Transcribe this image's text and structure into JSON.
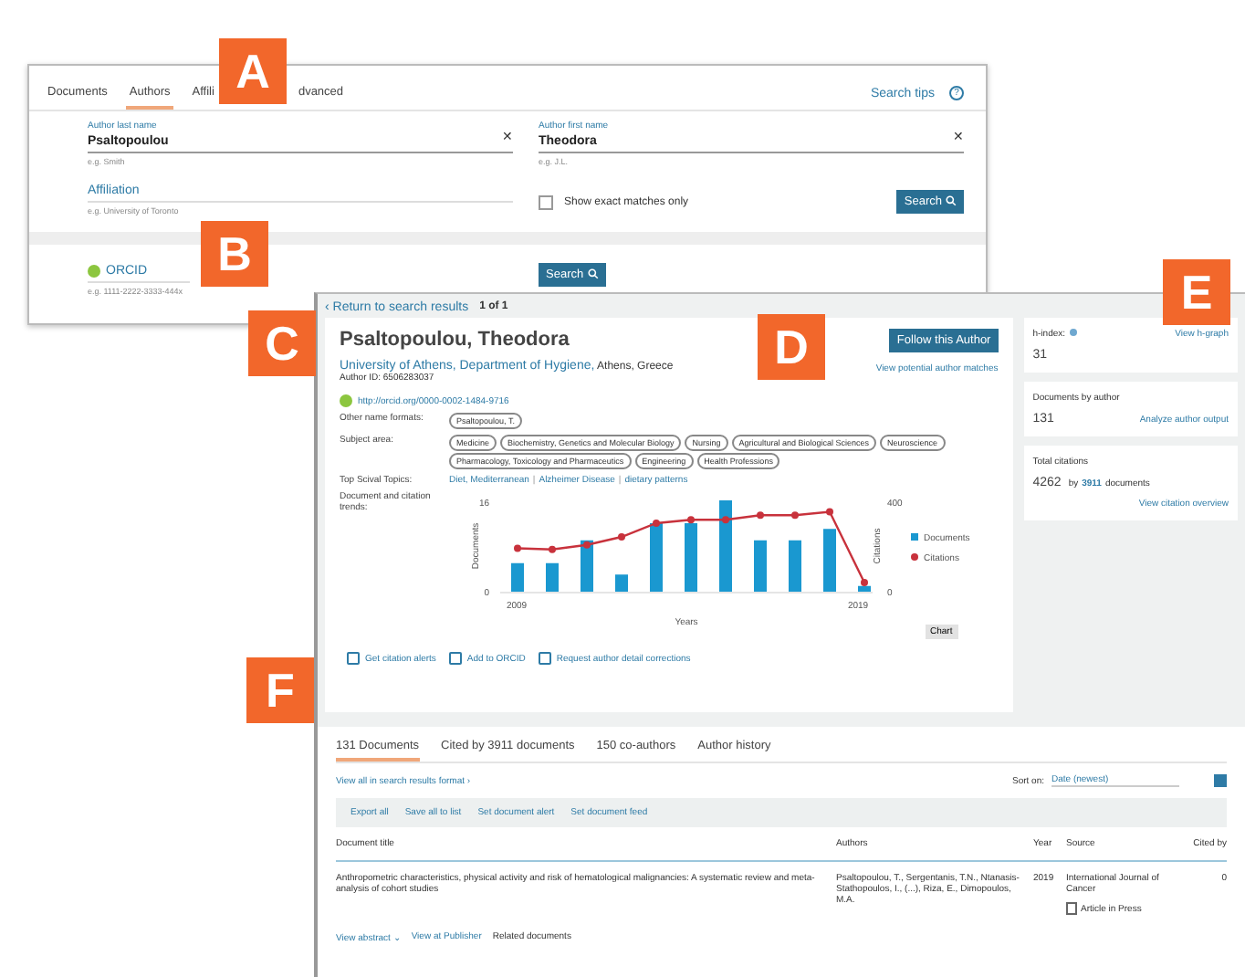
{
  "search_panel": {
    "tabs": [
      {
        "label": "Documents",
        "selected": false
      },
      {
        "label": "Authors",
        "selected": true
      },
      {
        "label": "Affili",
        "selected": false
      },
      {
        "label": "dvanced",
        "selected": false
      }
    ],
    "search_tips": "Search tips",
    "help_mark": "?",
    "clear_mark": "✕",
    "last_name": {
      "label": "Author last name",
      "value": "Psaltopoulou",
      "hint": "e.g. Smith"
    },
    "first_name": {
      "label": "Author first name",
      "value": "Theodora",
      "hint": "e.g. J.L."
    },
    "affiliation": {
      "placeholder": "Affiliation",
      "hint": "e.g. University of Toronto"
    },
    "exact_matches": {
      "label": "Show exact matches only",
      "checked": false
    },
    "search_button": "Search",
    "orcid": {
      "placeholder": "ORCID",
      "hint": "e.g. 1111-2222-3333-444x"
    },
    "orcid_search_button": "Search"
  },
  "author_page": {
    "back_link": "‹ Return to search results",
    "pager": "1 of 1",
    "name": "Psaltopoulou, Theodora",
    "affiliation_link": "University of Athens, Department of Hygiene,",
    "affiliation_place": "Athens, Greece",
    "author_id": "Author ID: 6506283037",
    "orcid_link": "http://orcid.org/0000-0002-1484-9716",
    "follow_button": "Follow this Author",
    "matches_link": "View potential author matches",
    "other_names_label": "Other name formats:",
    "other_names": [
      "Psaltopoulou, T."
    ],
    "subject_label": "Subject area:",
    "subjects": [
      "Medicine",
      "Biochemistry, Genetics and Molecular Biology",
      "Nursing",
      "Agricultural and Biological Sciences",
      "Neuroscience",
      "Pharmacology, Toxicology and Pharmaceutics",
      "Engineering",
      "Health Professions"
    ],
    "topics_label": "Top Scival Topics:",
    "topic_separator": "|",
    "topics": [
      "Diet, Mediterranean",
      "Alzheimer Disease",
      "dietary patterns"
    ],
    "trends_label": "Document and citation trends:",
    "chart": {
      "left_ticks": [
        "16",
        "0"
      ],
      "right_ticks": [
        "400",
        "0"
      ],
      "x_labels": [
        "2009",
        "2019"
      ],
      "x_title": "Years",
      "left_title": "Documents",
      "right_title": "Citations",
      "legend": [
        "Documents",
        "Citations"
      ],
      "chart_button": "Chart"
    },
    "actions": [
      "Get citation alerts",
      "Add to ORCID",
      "Request author detail corrections"
    ],
    "metrics": [
      {
        "label": "h-index:",
        "value": "31",
        "link": "View h-graph"
      },
      {
        "label": "Documents by author",
        "value": "131",
        "link": "Analyze author output"
      },
      {
        "label": "Total citations",
        "value": "4262",
        "by": "by",
        "by_link": "3911",
        "by_rest": "documents",
        "link": "View citation overview"
      }
    ],
    "tabs": [
      {
        "label": "131 Documents",
        "selected": true
      },
      {
        "label": "Cited by 3911 documents",
        "selected": false
      },
      {
        "label": "150 co-authors",
        "selected": false
      },
      {
        "label": "Author history",
        "selected": false
      }
    ],
    "view_all": "View all in search results format ›",
    "sort_label": "Sort on:",
    "sort_value": "Date (newest)",
    "toolbar": [
      "Export all",
      "Save all to list",
      "Set document alert",
      "Set document feed"
    ],
    "columns": [
      "Document title",
      "Authors",
      "Year",
      "Source",
      "Cited by"
    ],
    "rows": [
      {
        "title": "Anthropometric characteristics, physical activity and risk of hematological malignancies: A systematic review and meta-analysis of cohort studies",
        "authors": "Psaltopoulou, T., Sergentanis, T.N., Ntanasis-Stathopoulos, I., (...), Riza, E., Dimopoulos, M.A.",
        "year": "2019",
        "source": "International Journal of Cancer",
        "cited": "0",
        "status": "Article in Press"
      }
    ],
    "row_links": [
      "View abstract ⌄",
      "View at Publisher",
      "Related documents"
    ]
  },
  "badges": [
    "A",
    "B",
    "C",
    "D",
    "E",
    "F"
  ]
}
